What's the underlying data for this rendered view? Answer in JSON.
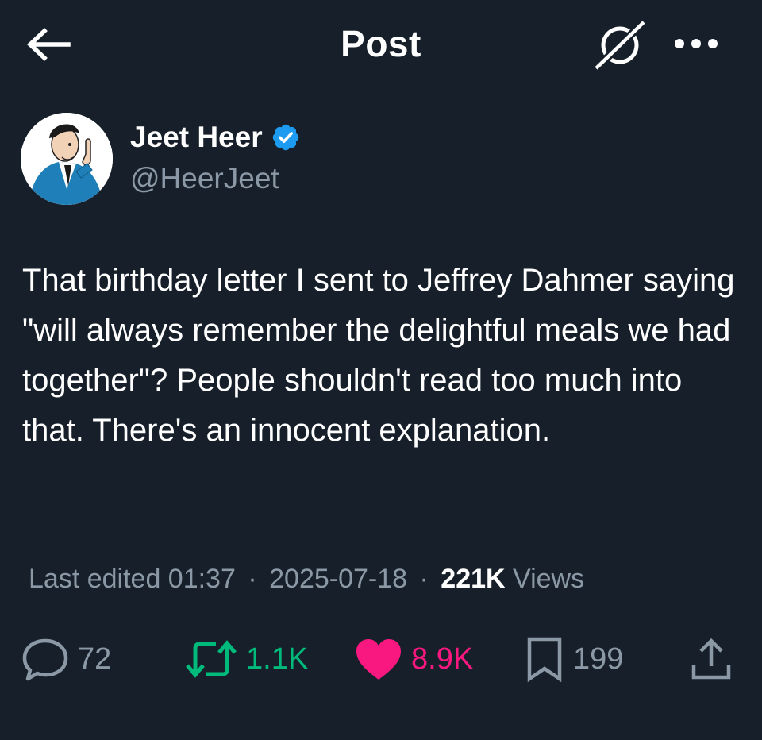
{
  "header": {
    "title": "Post",
    "back_icon": "arrow-left-icon",
    "grok_icon": "grok-icon",
    "more_icon": "more-horizontal-icon"
  },
  "author": {
    "display_name": "Jeet Heer",
    "handle": "@HeerJeet",
    "verified_icon": "verified-badge-icon",
    "verified_color": "#1d9bf0"
  },
  "tweet": {
    "text": "That birthday letter I sent to Jeffrey Dahmer saying \"will always remember the delightful meals we had together\"? People shouldn't read too much into that. There's an innocent explanation."
  },
  "meta": {
    "edited_time": "Last edited 01:37",
    "separator": "·",
    "date": "2025-07-18",
    "views_count": "221K",
    "views_label": "Views"
  },
  "actions": {
    "replies": "72",
    "reposts": "1.1K",
    "likes": "8.9K",
    "bookmarks": "199"
  },
  "colors": {
    "background": "#17202a",
    "repost": "#00ba7c",
    "like": "#f91880",
    "muted": "#8b98a5"
  }
}
